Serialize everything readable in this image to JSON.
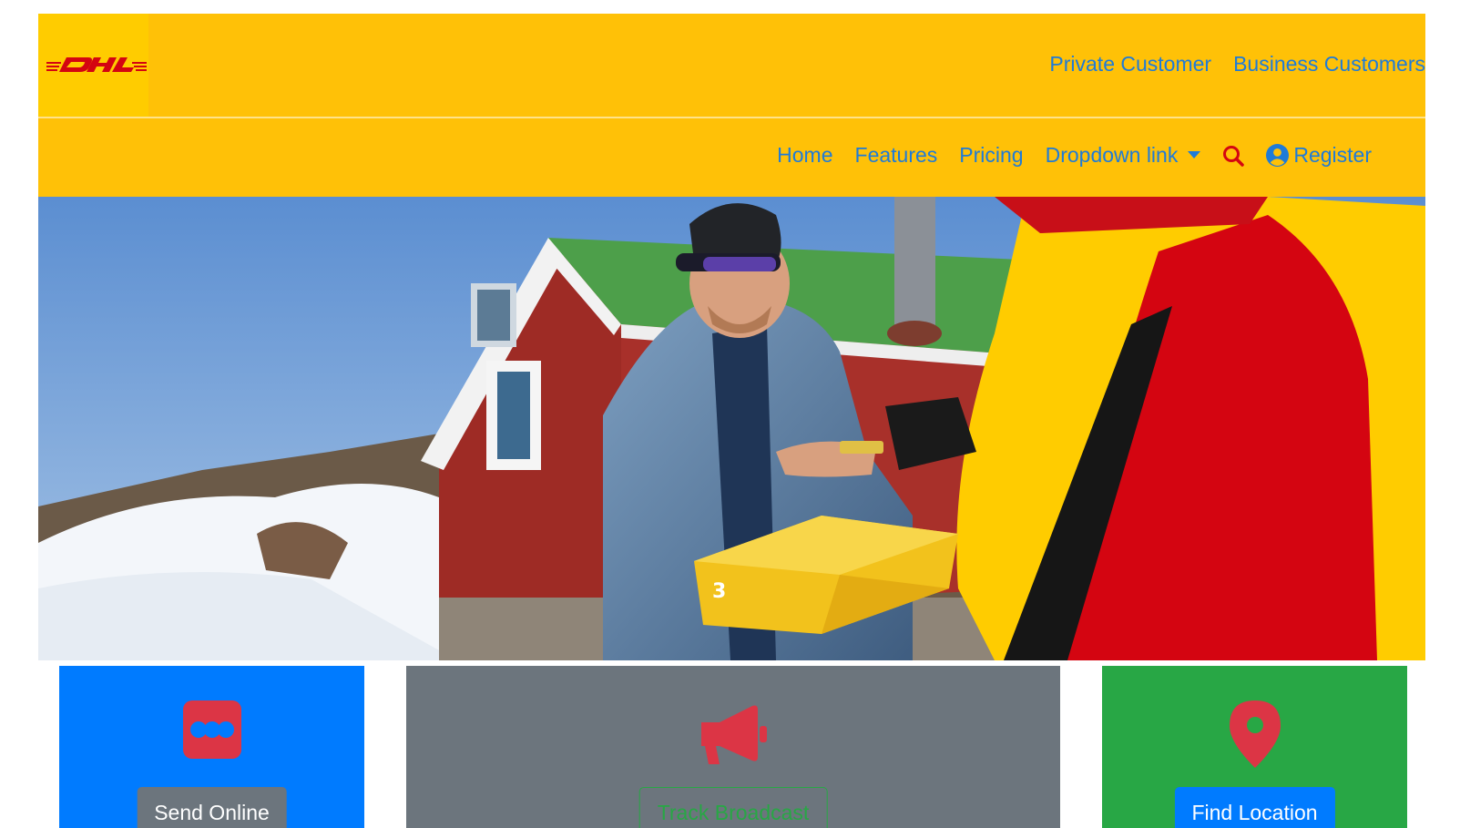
{
  "brand": {
    "logo_text": "DHL",
    "colors": {
      "header_yellow": "#FFC107",
      "logo_yellow": "#FFCC00",
      "dhl_red": "#D40511",
      "link_blue": "#007BFF"
    }
  },
  "top_links": {
    "private": "Private Customer",
    "business": "Business Customers"
  },
  "nav": {
    "items": [
      "Home",
      "Features",
      "Pricing"
    ],
    "dropdown_label": "Dropdown link",
    "search_icon": "search-icon",
    "register_icon": "user-circle-icon",
    "register_label": "Register"
  },
  "hero": {
    "image_subject": "courier-handing-package-photo"
  },
  "cards": [
    {
      "icon": "ellipsis-box-icon",
      "button_label": "Send Online",
      "bg": "#007BFF",
      "button_style": "secondary"
    },
    {
      "icon": "megaphone-icon",
      "button_label": "Track Broadcast",
      "bg": "#6C757D",
      "button_style": "outline-success"
    },
    {
      "icon": "map-marker-icon",
      "button_label": "Find Location",
      "bg": "#28A745",
      "button_style": "primary"
    }
  ]
}
